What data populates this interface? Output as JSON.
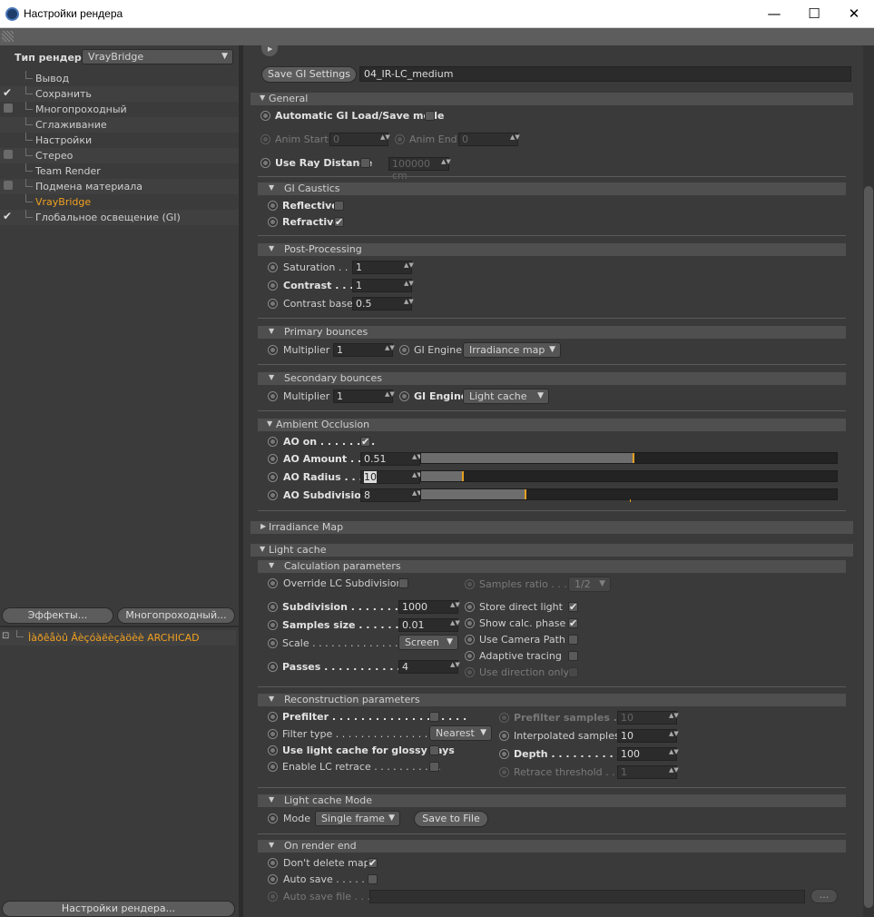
{
  "window": {
    "title": "Настройки рендера",
    "minimize": "—",
    "maximize": "☐",
    "close": "✕"
  },
  "left": {
    "render_type_label": "Тип рендера",
    "render_type_value": "VrayBridge",
    "items": [
      {
        "label": "Вывод",
        "check": "none",
        "selected": false
      },
      {
        "label": "Сохранить",
        "check": "tick",
        "selected": false
      },
      {
        "label": "Многопроходный",
        "check": "box",
        "selected": false
      },
      {
        "label": "Сглаживание",
        "check": "none",
        "selected": false
      },
      {
        "label": "Настройки",
        "check": "none",
        "selected": false
      },
      {
        "label": "Стерео",
        "check": "box",
        "selected": false
      },
      {
        "label": "Team Render",
        "check": "none",
        "selected": false
      },
      {
        "label": "Подмена материала",
        "check": "box",
        "selected": false
      },
      {
        "label": "VrayBridge",
        "check": "none",
        "selected": true
      },
      {
        "label": "Глобальное освещение (GI)",
        "check": "tick",
        "selected": false
      }
    ],
    "effects_button": "Эффекты...",
    "multipass_button": "Многопроходный...",
    "preset_icon": "⊡",
    "preset_label": "Ìàðêåòû Âèçóàëèçàöèè ARCHICAD",
    "settings_button": "Настройки рендера..."
  },
  "top": {
    "save_gi_button": "Save GI Settings",
    "gi_file": "04_IR-LC_medium"
  },
  "general": {
    "title": "General",
    "auto_gi": "Automatic GI Load/Save mode",
    "anim_start_label": "Anim Start",
    "anim_start": "0",
    "anim_end_label": "Anim End",
    "anim_end": "0",
    "ray_dist_label": "Use Ray Distance",
    "ray_dist": "100000 cm"
  },
  "caustics": {
    "title": "GI Caustics",
    "reflective": "Reflective",
    "refractive": "Refractive"
  },
  "post": {
    "title": "Post-Processing",
    "saturation_label": "Saturation . . . .",
    "saturation": "1",
    "contrast_label": "Contrast . . . . .",
    "contrast": "1",
    "contrast_base_label": "Contrast base",
    "contrast_base": "0.5"
  },
  "primary": {
    "title": "Primary bounces",
    "mult_label": "Multiplier",
    "mult": "1",
    "engine_label": "GI Engine",
    "engine": "Irradiance map"
  },
  "secondary": {
    "title": "Secondary bounces",
    "mult_label": "Multiplier",
    "mult": "1",
    "engine_label": "GI Engine",
    "engine": "Light cache"
  },
  "ao": {
    "title": "Ambient Occlusion",
    "on_label": "AO on . . . . . . . .",
    "amount_label": "AO Amount . . .",
    "amount": "0.51",
    "amount_frac": 0.51,
    "radius_label": "AO Radius . . . .",
    "radius": "10",
    "radius_frac": 0.1,
    "subdiv_label": "AO Subdivision",
    "subdiv": "8",
    "subdiv_frac": 0.25
  },
  "irr": {
    "title": "Irradiance Map"
  },
  "lc": {
    "title": "Light cache",
    "calc_title": "Calculation parameters",
    "override": "Override LC Subdivision",
    "samples_ratio_label": "Samples ratio . . .",
    "samples_ratio": "1/2",
    "subdivision_label": "Subdivision . . . . . . . . . . .",
    "subdivision": "1000",
    "samples_size_label": "Samples size . . . . . . . . .",
    "samples_size": "0.01",
    "scale_label": "Scale . . . . . . . . . . . . . . . .",
    "scale": "Screen",
    "passes_label": "Passes . . . . . . . . . . . . . .",
    "passes": "4",
    "store_direct": "Store direct light",
    "show_calc": "Show calc. phase",
    "camera_path": "Use Camera Path",
    "adaptive": "Adaptive tracing",
    "use_dir": "Use direction only",
    "recon_title": "Reconstruction parameters",
    "prefilter": "Prefilter . . . . . . . . . . . . . . . . . . .",
    "filter_type_label": "Filter type . . . . . . . . . . . . . . .",
    "filter_type": "Nearest",
    "glossy": "Use light cache for glossy rays",
    "retrace": "Enable LC retrace . . . . . . . . . . .",
    "prefilter_samples_label": "Prefilter samples . . . .",
    "prefilter_samples": "10",
    "interp_label": "Interpolated samples",
    "interp": "10",
    "depth_label": "Depth . . . . . . . . . . . . .",
    "depth": "100",
    "retrace_thr_label": "Retrace threshold . . . .",
    "retrace_thr": "1",
    "mode_title": "Light cache Mode",
    "mode_label": "Mode",
    "mode": "Single frame",
    "save_file": "Save to File",
    "end_title": "On render end",
    "dont_delete": "Don't delete map",
    "auto_save": "Auto save . . . . . . .",
    "auto_save_file": "Auto save file . . . .",
    "browse": "..."
  }
}
